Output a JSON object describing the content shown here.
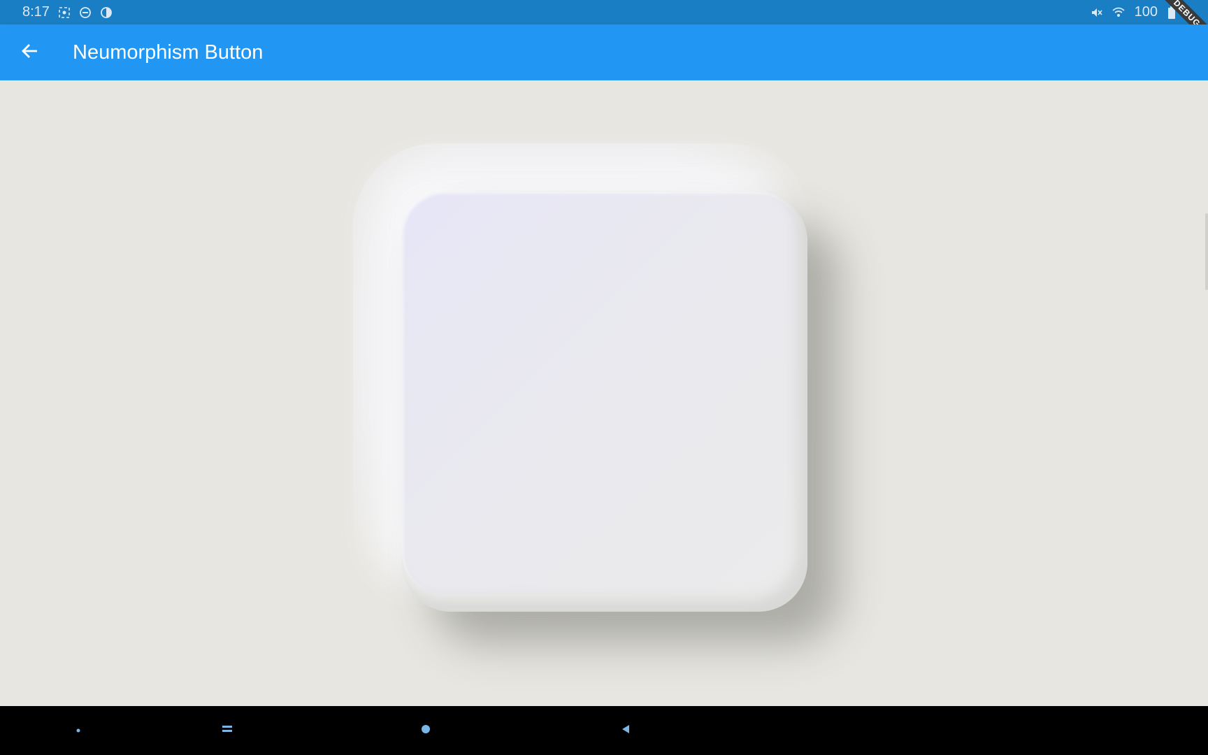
{
  "status_bar": {
    "time": "8:17",
    "battery": "100",
    "icons_left": [
      "screenshot-icon",
      "do-not-disturb-icon",
      "data-saver-icon"
    ],
    "icons_right": [
      "mute-icon",
      "wifi-icon",
      "battery-icon"
    ],
    "color": "#1a7ec4"
  },
  "debug_banner": {
    "label": "DEBUG"
  },
  "app_bar": {
    "title": "Neumorphism Button",
    "back_icon": "arrow-back-icon",
    "color": "#2196f3"
  },
  "content": {
    "background": "#e7e6e1",
    "button": {
      "label": "",
      "surface_color": "#ececec"
    }
  },
  "navigation_bar": {
    "buttons": [
      "dot-icon",
      "recents-icon",
      "home-icon",
      "back-triangle-icon"
    ],
    "color": "#000000"
  }
}
